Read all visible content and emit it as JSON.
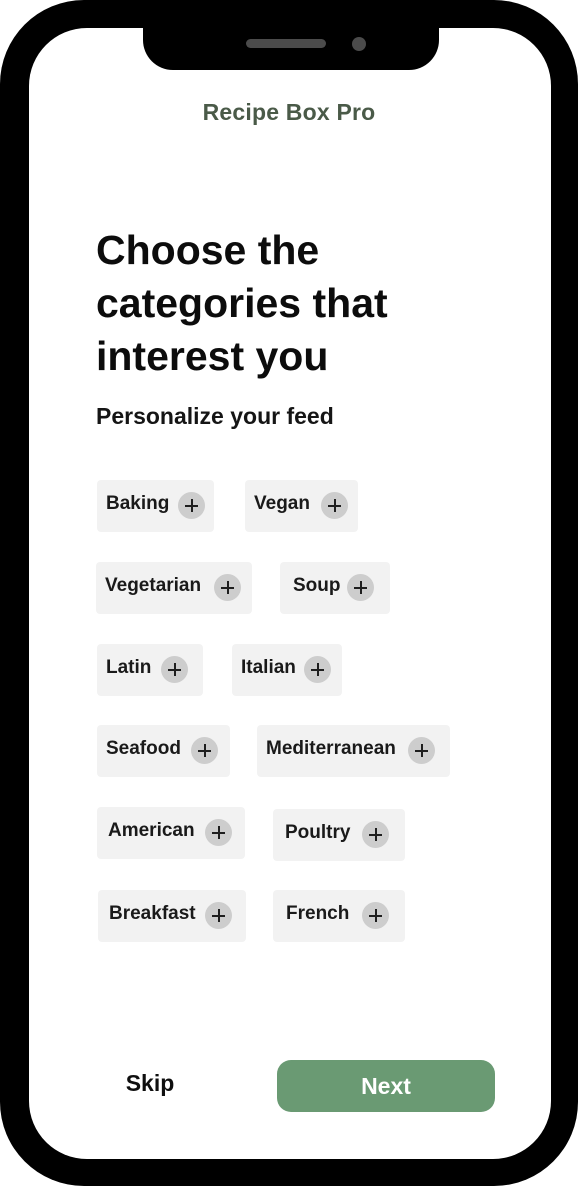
{
  "app": {
    "title": "Recipe Box Pro"
  },
  "onboarding": {
    "heading": "Choose the categories that interest you",
    "subheading": "Personalize your feed"
  },
  "categories": [
    {
      "label": "Baking",
      "icon": "plus-icon"
    },
    {
      "label": "Vegan",
      "icon": "plus-icon"
    },
    {
      "label": "Vegetarian",
      "icon": "plus-icon"
    },
    {
      "label": "Soup",
      "icon": "plus-icon"
    },
    {
      "label": "Latin",
      "icon": "plus-icon"
    },
    {
      "label": "Italian",
      "icon": "plus-icon"
    },
    {
      "label": "Seafood",
      "icon": "plus-icon"
    },
    {
      "label": "Mediterranean",
      "icon": "plus-icon"
    },
    {
      "label": "American",
      "icon": "plus-icon"
    },
    {
      "label": "Poultry",
      "icon": "plus-icon"
    },
    {
      "label": "Breakfast",
      "icon": "plus-icon"
    },
    {
      "label": "French",
      "icon": "plus-icon"
    }
  ],
  "actions": {
    "skip_label": "Skip",
    "next_label": "Next"
  },
  "colors": {
    "accent": "#6a9a73",
    "app_title": "#4a5a48",
    "chip_background": "#f2f2f2",
    "plus_circle": "#cdcdcd"
  }
}
